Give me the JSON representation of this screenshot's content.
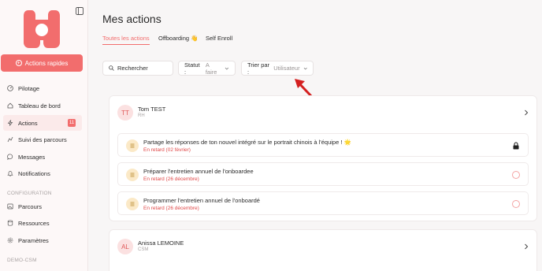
{
  "sidebar": {
    "quick_action": "Actions rapides",
    "items": [
      {
        "label": "Pilotage",
        "icon": "gauge-icon"
      },
      {
        "label": "Tableau de bord",
        "icon": "home-icon"
      },
      {
        "label": "Actions",
        "icon": "bolt-icon",
        "badge": "11",
        "active": true
      },
      {
        "label": "Suivi des parcours",
        "icon": "route-icon"
      },
      {
        "label": "Messages",
        "icon": "message-icon"
      },
      {
        "label": "Notifications",
        "icon": "bell-icon"
      }
    ],
    "config_label": "CONFIGURATION",
    "config_items": [
      {
        "label": "Parcours",
        "icon": "image-icon"
      },
      {
        "label": "Ressources",
        "icon": "database-icon"
      },
      {
        "label": "Paramètres",
        "icon": "gear-icon"
      }
    ],
    "demo_label": "DEMO-CSM"
  },
  "main": {
    "title": "Mes actions",
    "tabs": [
      {
        "label": "Toutes les actions",
        "active": true
      },
      {
        "label": "Offboarding 👋"
      },
      {
        "label": "Self Enroll"
      }
    ],
    "search_label": "Rechercher",
    "status_label": "Statut :",
    "status_value": "A faire",
    "sort_label": "Trier par :",
    "sort_value": "Utilisateur"
  },
  "users": [
    {
      "initials": "TT",
      "name": "Tom TEST",
      "role": "RH",
      "tasks": [
        {
          "title": "Partage les réponses de ton nouvel intégré sur le portrait chinois à l'équipe ! 🌟",
          "late": "En retard (02 février)",
          "status": "lock-icon"
        },
        {
          "title": "Préparer l'entretien annuel de l'onboardee",
          "late": "En retard (26 décembre)",
          "status": "radio"
        },
        {
          "title": "Programmer l'entretien annuel de l'onboardé",
          "late": "En retard (26 décembre)",
          "status": "radio"
        }
      ]
    },
    {
      "initials": "AL",
      "name": "Anissa LEMOINE",
      "role": "CSM",
      "tasks": []
    }
  ],
  "colors": {
    "accent": "#f26d6d",
    "arrow": "#d42020",
    "late": "#e04848"
  }
}
